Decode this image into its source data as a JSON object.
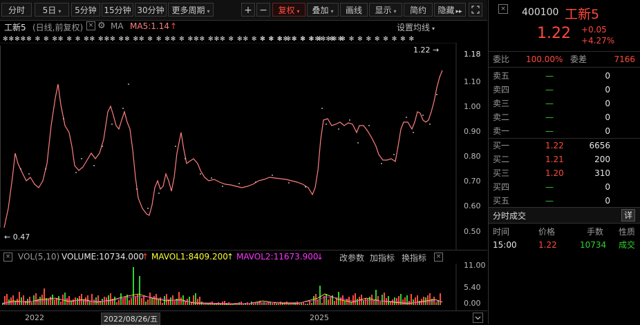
{
  "toolbar": {
    "items": [
      {
        "label": "分时",
        "caret": ""
      },
      {
        "label": "5日",
        "caret": "▾"
      },
      {
        "label": "5分钟",
        "caret": ""
      },
      {
        "label": "15分钟",
        "caret": ""
      },
      {
        "label": "30分钟",
        "caret": ""
      },
      {
        "label": "更多周期",
        "caret": "▾"
      }
    ],
    "plus": "+",
    "minus": "−",
    "fuquan": "复权",
    "overlay": "叠加",
    "draw": "画线",
    "display": "显示",
    "simple": "简约",
    "hide": "隐藏",
    "hide_arrows": "▸▸"
  },
  "chart_head": {
    "name": "工新5",
    "mode": "(日线,前复权)",
    "ma_label": "MA",
    "ma5": "MA5:1.14",
    "ma_arrow": "↑",
    "settings": "设置均线",
    "settings_caret": "▾"
  },
  "price_axis": [
    "1.18",
    "1.10",
    "1.00",
    "0.90",
    "0.80",
    "0.70",
    "0.60",
    "0.50"
  ],
  "annotations": {
    "high": "1.22 →",
    "low": "← 0.47"
  },
  "volume_head": {
    "vol_label": "VOL(5,10)",
    "volume": "VOLUME:10734.000",
    "volume_arrow": "↑",
    "mavol1": "MAVOL1:8409.200",
    "mavol1_arrow": "↑",
    "mavol2": "MAVOL2:11673.900",
    "mavol2_arrow": "↓",
    "modify": "改参数",
    "add": "加指标",
    "switch": "换指标"
  },
  "volume_axis": [
    "11.00",
    "5.40",
    "0.00"
  ],
  "time_axis": {
    "left": "2022",
    "cursor": "2022/08/26/五",
    "right": "2025"
  },
  "colors": {
    "up": "#ff4a3d",
    "down": "#2fd32f",
    "line": "#ff7f7f",
    "mavol1": "#ffff33",
    "mavol2": "#ff33ff"
  },
  "quote": {
    "code": "400100",
    "name": "工新5",
    "price": "1.22",
    "change": "+0.05",
    "change_pct": "+4.27%",
    "webi_label": "委比",
    "webi": "100.00%",
    "wecha_label": "委差",
    "wecha": "7166",
    "asks": [
      {
        "label": "卖五",
        "price": "—",
        "vol": "0"
      },
      {
        "label": "卖四",
        "price": "—",
        "vol": "0"
      },
      {
        "label": "卖三",
        "price": "—",
        "vol": "0"
      },
      {
        "label": "卖二",
        "price": "—",
        "vol": "0"
      },
      {
        "label": "卖一",
        "price": "—",
        "vol": "0"
      }
    ],
    "bids": [
      {
        "label": "买一",
        "price": "1.22",
        "vol": "6656"
      },
      {
        "label": "买二",
        "price": "1.21",
        "vol": "200"
      },
      {
        "label": "买三",
        "price": "1.20",
        "vol": "310"
      },
      {
        "label": "买四",
        "price": "—",
        "vol": "0"
      },
      {
        "label": "买五",
        "price": "—",
        "vol": "0"
      }
    ],
    "trades_title": "分时成交",
    "trades_detail": "详",
    "trades_headers": [
      "时间",
      "价格",
      "手数",
      "性质"
    ],
    "trades": [
      {
        "time": "15:00",
        "price": "1.22",
        "vol": "10734",
        "nature": "成交"
      }
    ]
  }
}
